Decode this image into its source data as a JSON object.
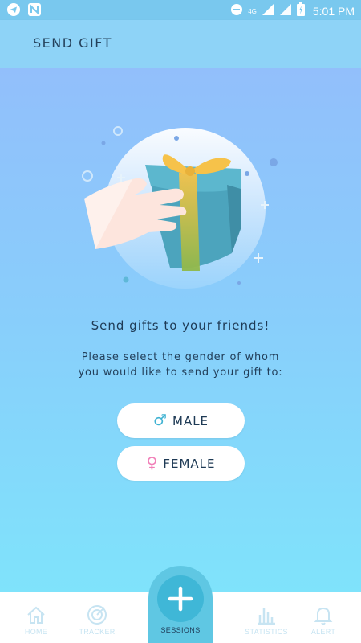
{
  "status_bar": {
    "time": "5:01 PM",
    "network": "4G"
  },
  "app_bar": {
    "title": "SEND GIFT"
  },
  "main": {
    "headline": "Send gifts to your friends!",
    "subtext_line1": "Please select the gender of whom",
    "subtext_line2": "you would like to send your gift to:",
    "buttons": {
      "male": "MALE",
      "female": "FEMALE"
    }
  },
  "bottom_nav": {
    "items": [
      {
        "label": "HOME",
        "icon": "home-icon"
      },
      {
        "label": "TRACKER",
        "icon": "target-icon"
      },
      {
        "label": "SESSIONS",
        "icon": "plus-icon"
      },
      {
        "label": "STATISTICS",
        "icon": "bar-chart-icon"
      },
      {
        "label": "ALERT",
        "icon": "bell-icon"
      }
    ]
  },
  "colors": {
    "accent": "#3fb7d7",
    "male": "#3fb2d2",
    "female": "#f17fb8",
    "text_dark": "#1e3a55"
  }
}
